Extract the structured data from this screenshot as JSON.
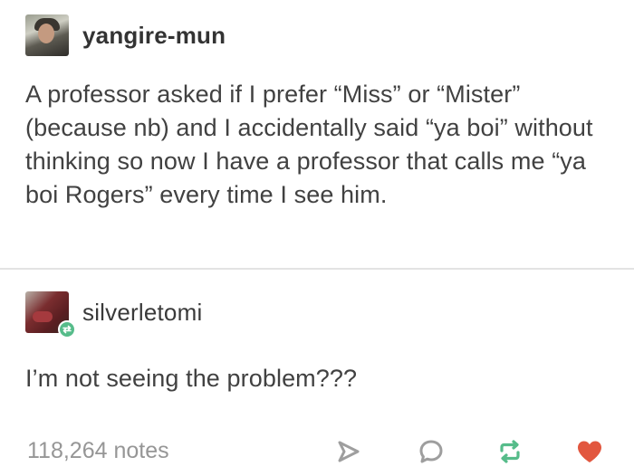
{
  "post": {
    "op": {
      "username": "yangire-mun",
      "avatar_icon": "user-avatar-photo",
      "text": "A professor asked if I prefer “Miss” or “Mister” (because nb) and I accidentally said “ya boi” without thinking so now I have a professor that calls me “ya boi Rogers” every time I see him."
    },
    "reply": {
      "username": "silverletomi",
      "avatar_icon": "user-avatar-photo",
      "badge_icon": "reblog-icon",
      "text": "I’m not seeing the problem???"
    },
    "footer": {
      "notes": "118,264 notes",
      "actions": [
        "share-icon",
        "reply-icon",
        "reblog-icon",
        "like-icon"
      ]
    }
  },
  "colors": {
    "reblog_green": "#56bc8a",
    "like_red": "#e2573f",
    "icon_gray": "#9e9e9e",
    "text": "#414141",
    "notes_gray": "#969696"
  }
}
